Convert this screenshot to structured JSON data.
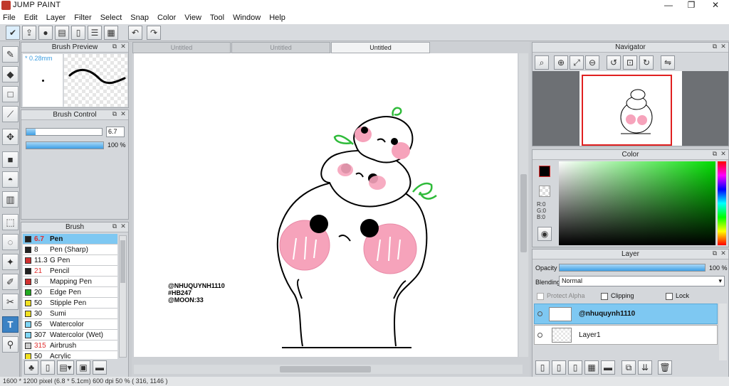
{
  "app": {
    "title": "JUMP PAINT"
  },
  "window_controls": {
    "minimize": "—",
    "maximize": "❐",
    "close": "✕"
  },
  "menu": [
    "File",
    "Edit",
    "Layer",
    "Filter",
    "Select",
    "Snap",
    "Color",
    "View",
    "Tool",
    "Window",
    "Help"
  ],
  "brush_preview": {
    "title": "Brush Preview",
    "size_label": "* 0.28mm"
  },
  "brush_control": {
    "title": "Brush Control",
    "size_value": "6.7",
    "opacity_value": "100 %",
    "size_fraction": 0.12,
    "opacity_fraction": 1.0
  },
  "brush_list": {
    "title": "Brush",
    "items": [
      {
        "size": "6.7",
        "name": "Pen",
        "color": "#222222",
        "size_color": "#e03030",
        "selected": true
      },
      {
        "size": "8",
        "name": "Pen (Sharp)",
        "color": "#222222",
        "size_color": "#111111",
        "selected": false
      },
      {
        "size": "11.3",
        "name": "G Pen",
        "color": "#d03030",
        "size_color": "#111111",
        "selected": false
      },
      {
        "size": "21",
        "name": "Pencil",
        "color": "#222222",
        "size_color": "#e03030",
        "selected": false
      },
      {
        "size": "8",
        "name": "Mapping Pen",
        "color": "#d03030",
        "size_color": "#111111",
        "selected": false
      },
      {
        "size": "20",
        "name": "Edge Pen",
        "color": "#22aa22",
        "size_color": "#111111",
        "selected": false
      },
      {
        "size": "50",
        "name": "Stipple Pen",
        "color": "#f0e020",
        "size_color": "#111111",
        "selected": false
      },
      {
        "size": "30",
        "name": "Sumi",
        "color": "#f0e020",
        "size_color": "#111111",
        "selected": false
      },
      {
        "size": "65",
        "name": "Watercolor",
        "color": "#7ed6f5",
        "size_color": "#111111",
        "selected": false
      },
      {
        "size": "307",
        "name": "Watercolor (Wet)",
        "color": "#7ed6f5",
        "size_color": "#111111",
        "selected": false
      },
      {
        "size": "315",
        "name": "Airbrush",
        "color": "#cccccc",
        "size_color": "#e03030",
        "selected": false
      },
      {
        "size": "50",
        "name": "Acrylic",
        "color": "#f0e020",
        "size_color": "#111111",
        "selected": false
      }
    ]
  },
  "tabs": [
    {
      "label": "Untitled",
      "active": false
    },
    {
      "label": "Untitled",
      "active": false
    },
    {
      "label": "Untitled",
      "active": true
    }
  ],
  "canvas": {
    "watermark": [
      "@NHUQUYNH1110",
      "#HB247",
      "@MOON:33"
    ]
  },
  "navigator": {
    "title": "Navigator"
  },
  "color_panel": {
    "title": "Color",
    "r": "R:0",
    "g": "G:0",
    "b": "B:0",
    "main_color": "#000000"
  },
  "layer_panel": {
    "title": "Layer",
    "opacity_label": "Opacity",
    "opacity_value": "100 %",
    "blending_label": "Blending",
    "blending_value": "Normal",
    "protect_alpha": "Protect Alpha",
    "clipping": "Clipping",
    "lock": "Lock",
    "layers": [
      {
        "name": "@nhuquynh1110",
        "selected": true
      },
      {
        "name": "Layer1",
        "selected": false
      }
    ]
  },
  "status": {
    "text": "1600 * 1200 pixel   (6.8 * 5.1cm)   600 dpi   50 %   ( 316, 1146 )"
  }
}
